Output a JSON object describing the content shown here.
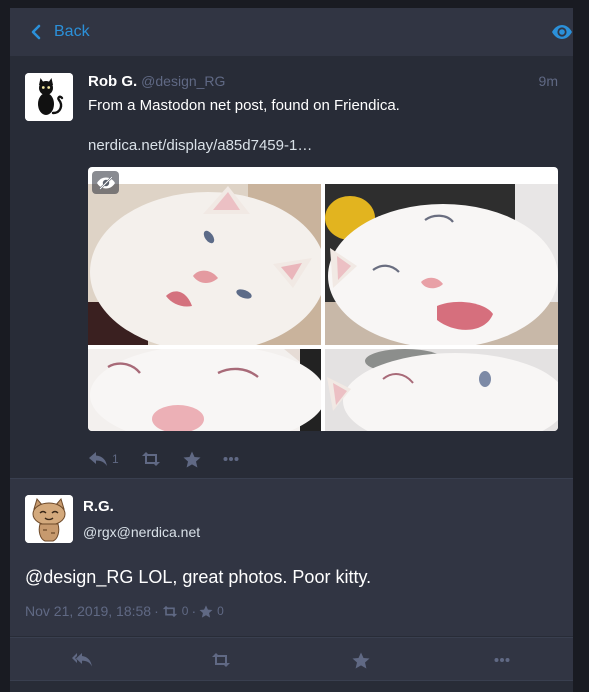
{
  "header": {
    "back_label": "Back",
    "back_icon": "chevron-left-icon",
    "visibility_icon": "eye-icon",
    "accent": "#2b90d9"
  },
  "status": {
    "display_name": "Rob G.",
    "acct": "@design_RG",
    "relative_time": "9m",
    "content": "From a Mastodon net post, found on Friendica.",
    "link": "nerdica.net/display/a85d7459-1…",
    "media_count": 4,
    "actions": {
      "reply_count": "1",
      "reblog_icon": "retweet-icon",
      "favourite_icon": "star-icon",
      "more_icon": "ellipsis-icon"
    }
  },
  "detailed": {
    "display_name": "R.G.",
    "acct": "@rgx@nerdica.net",
    "content": "@design_RG LOL, great photos. Poor kitty.",
    "datetime": "Nov 21, 2019, 18:58",
    "separator": "·",
    "reblog_count": "0",
    "favourite_count": "0"
  },
  "colors": {
    "background": "#191b22",
    "column": "#282c37",
    "header": "#313543",
    "muted": "#606984",
    "link": "#d9e1e8"
  }
}
